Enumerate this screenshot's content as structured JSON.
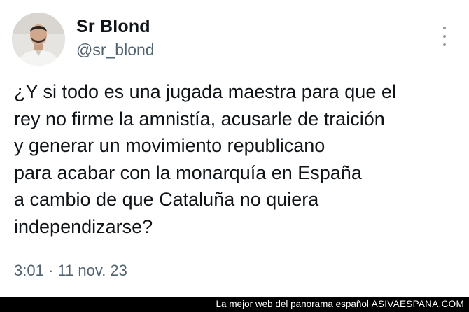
{
  "author": {
    "name": "Sr Blond",
    "handle": "@sr_blond",
    "avatar_icon": "profile-photo"
  },
  "menu_icon": "more-vertical-icon",
  "tweet": {
    "lines": [
      "¿Y si todo es una jugada maestra para que el",
      "rey no firme la amnistía, acusarle de traición",
      "y generar un movimiento republicano",
      "para acabar con la monarquía en España",
      "a cambio de que Cataluña no quiera",
      "independizarse?"
    ],
    "time": "3:01",
    "separator": "·",
    "date": "11 nov. 23"
  },
  "watermark": {
    "text": "La mejor web del panorama español",
    "site": "ASIVAESPANA.COM"
  }
}
